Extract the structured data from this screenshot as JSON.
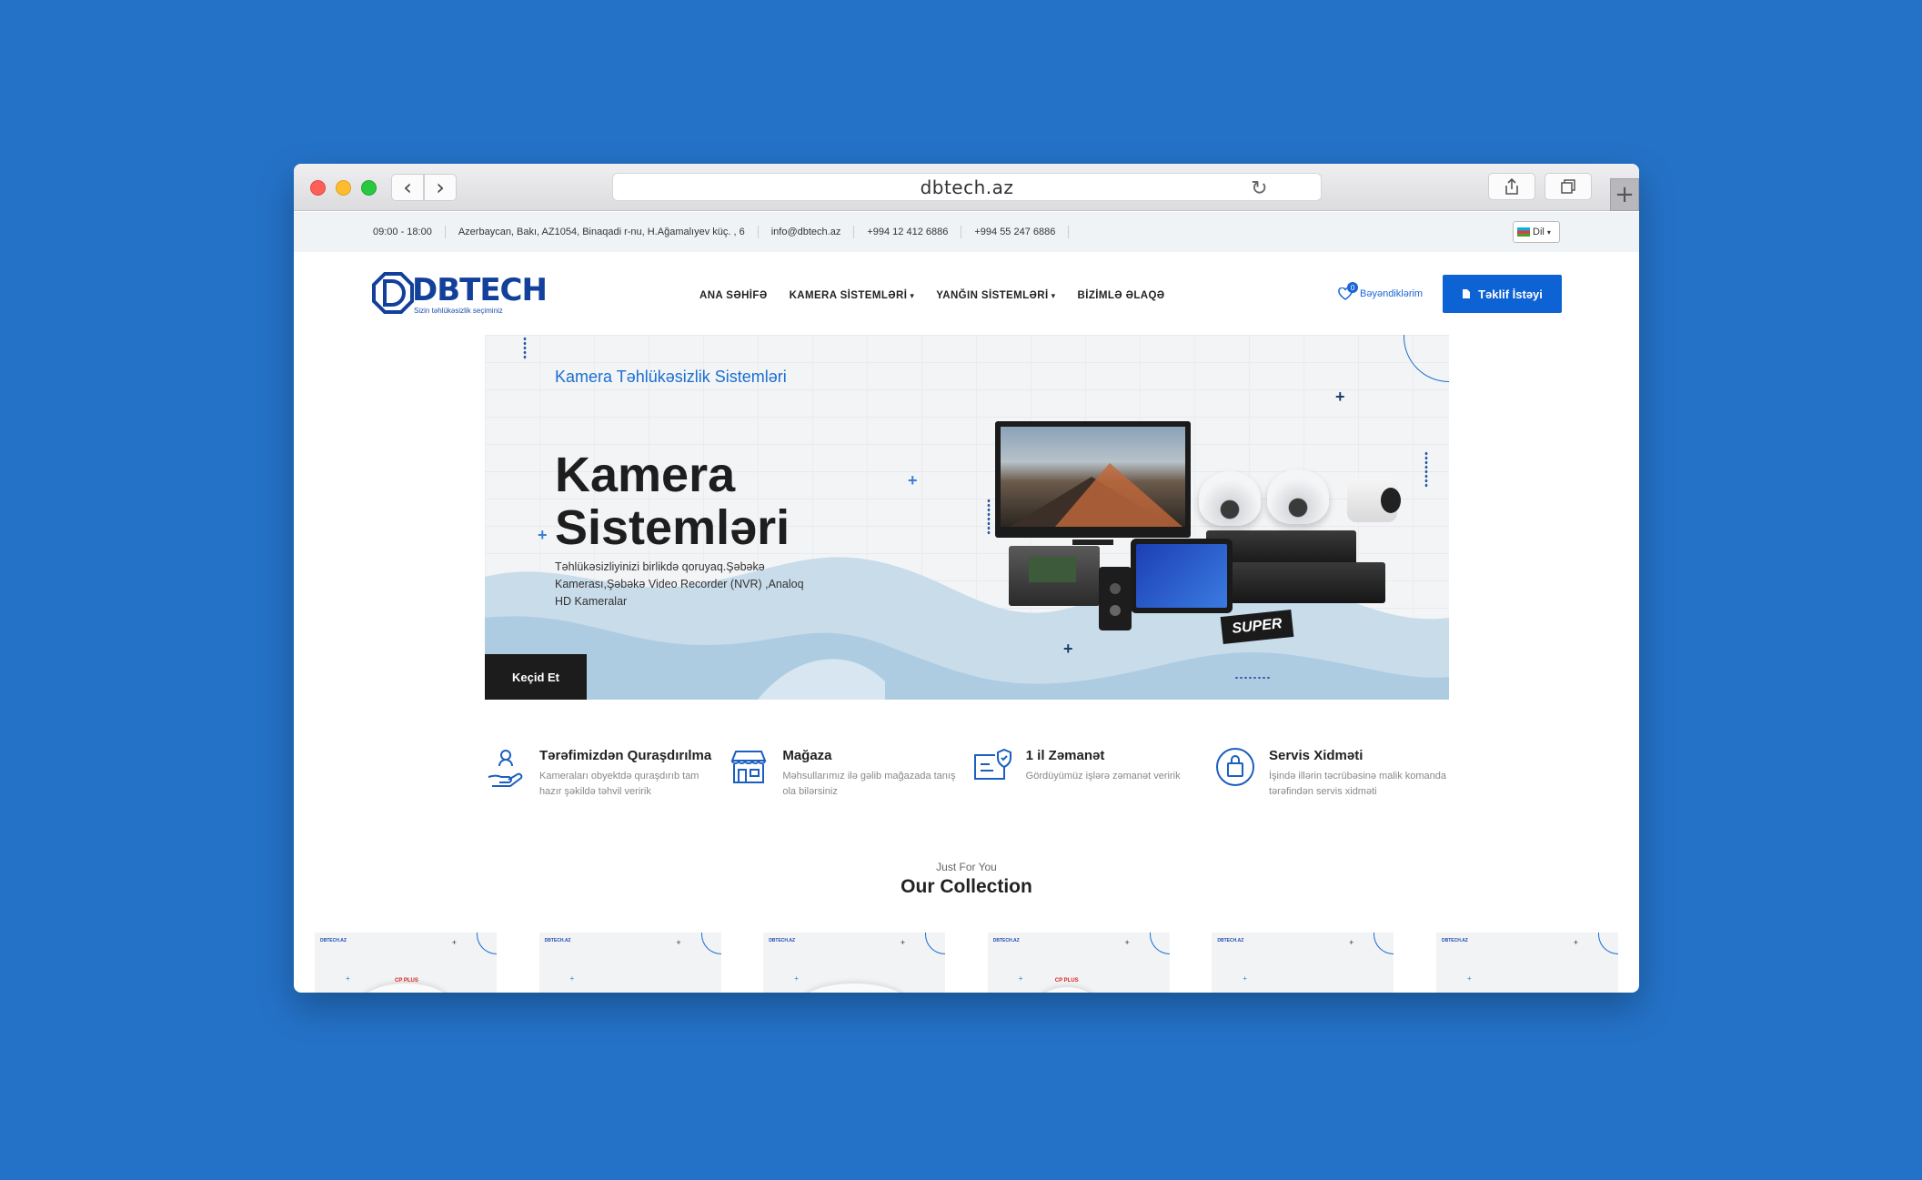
{
  "browser": {
    "url": "dbtech.az"
  },
  "topbar": {
    "hours": "09:00 - 18:00",
    "address": "Azerbaycan, Bakı, AZ1054, Binaqadi r-nu, H.Ağamalıyev küç. , 6",
    "email": "info@dbtech.az",
    "phone1": "+994 12 412 6886",
    "phone2": "+994 55 247 6886",
    "language_label": "Dil"
  },
  "header": {
    "logo_text": "DBTECH",
    "logo_tagline": "Sizin təhlükəsizlik seçiminiz",
    "nav": [
      {
        "label": "ANA SƏHİFƏ"
      },
      {
        "label": "KAMERA SİSTEMLƏRİ"
      },
      {
        "label": "YANĞIN SİSTEMLƏRİ"
      },
      {
        "label": "BİZİMLƏ ƏLAQƏ"
      }
    ],
    "wishlist_label": "Bəyəndiklərim",
    "wishlist_count": "0",
    "quote_button": "Təklif İstəyi"
  },
  "hero": {
    "subtitle": "Kamera Təhlükəsizlik Sistemləri",
    "title": "Kamera Sistemləri",
    "description": "Təhlükəsizliyinizi birlikdə qoruyaq.Şəbəkə Kamerası,Şəbəkə Video Recorder (NVR) ,Analoq HD Kameralar",
    "cta": "Keçid Et",
    "badge": "SUPER"
  },
  "features": [
    {
      "icon": "hand-installation-icon",
      "title": "Tərəfimizdən Quraşdırılma",
      "desc": "Kameraları obyektdə quraşdırıb tam hazır şəkildə təhvil veririk"
    },
    {
      "icon": "store-icon",
      "title": "Mağaza",
      "desc": "Məhsullarımız ilə gəlib mağazada tanış ola bilərsiniz"
    },
    {
      "icon": "warranty-icon",
      "title": "1 il Zəmanət",
      "desc": "Gördüyümüz işlərə zəmanət veririk"
    },
    {
      "icon": "service-bag-icon",
      "title": "Servis Xidməti",
      "desc": "İşində illərin təcrübəsinə malik komanda tərəfindən servis xidməti"
    }
  ],
  "collection": {
    "subtitle": "Just For You",
    "title": "Our Collection",
    "cards": [
      {
        "brand": "CP PLUS"
      },
      {
        "brand": ""
      },
      {
        "brand": ""
      },
      {
        "brand": "CP PLUS"
      },
      {
        "brand": ""
      },
      {
        "brand": ""
      }
    ]
  },
  "colors": {
    "background": "#2472c8",
    "accent": "#0d63d3",
    "logo": "#12409a"
  }
}
